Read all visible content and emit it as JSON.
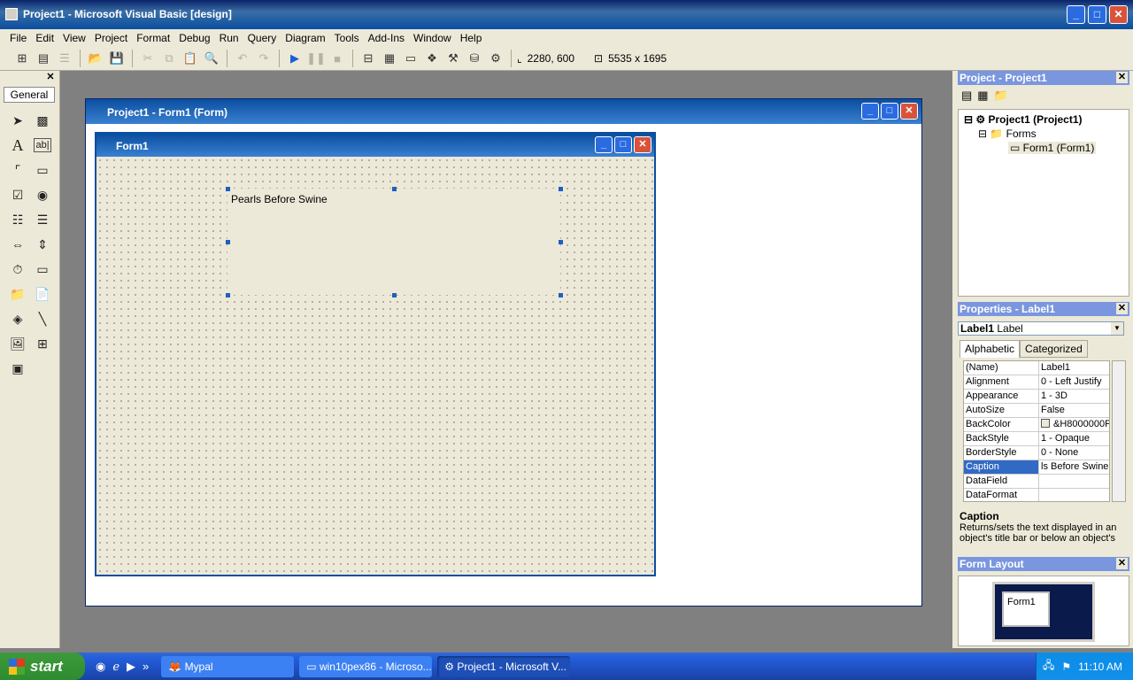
{
  "app": {
    "title": "Project1 - Microsoft Visual Basic [design]"
  },
  "menu": [
    "File",
    "Edit",
    "View",
    "Project",
    "Format",
    "Debug",
    "Run",
    "Query",
    "Diagram",
    "Tools",
    "Add-Ins",
    "Window",
    "Help"
  ],
  "toolbar": {
    "position": "2280, 600",
    "size": "5535 x 1695"
  },
  "toolbox": {
    "tab": "General"
  },
  "project_window": {
    "title": "Project1 - Form1 (Form)"
  },
  "form": {
    "title": "Form1",
    "label_caption": "Pearls Before Swine"
  },
  "project_explorer": {
    "title": "Project - Project1",
    "root": "Project1 (Project1)",
    "folder": "Forms",
    "item": "Form1 (Form1)"
  },
  "properties": {
    "title": "Properties - Label1",
    "object": "Label1",
    "object_type": "Label",
    "tabs": [
      "Alphabetic",
      "Categorized"
    ],
    "rows": [
      {
        "name": "(Name)",
        "value": "Label1"
      },
      {
        "name": "Alignment",
        "value": "0 - Left Justify"
      },
      {
        "name": "Appearance",
        "value": "1 - 3D"
      },
      {
        "name": "AutoSize",
        "value": "False"
      },
      {
        "name": "BackColor",
        "value": "&H8000000F"
      },
      {
        "name": "BackStyle",
        "value": "1 - Opaque"
      },
      {
        "name": "BorderStyle",
        "value": "0 - None"
      },
      {
        "name": "Caption",
        "value": "ls Before Swine"
      },
      {
        "name": "DataField",
        "value": ""
      },
      {
        "name": "DataFormat",
        "value": ""
      }
    ],
    "desc_title": "Caption",
    "desc_text": "Returns/sets the text displayed in an object's title bar or below an object's"
  },
  "form_layout": {
    "title": "Form Layout",
    "form_label": "Form1"
  },
  "taskbar": {
    "start": "start",
    "tasks": [
      "Mypal",
      "win10pex86 - Microso...",
      "Project1 - Microsoft V..."
    ],
    "clock": "11:10 AM"
  }
}
